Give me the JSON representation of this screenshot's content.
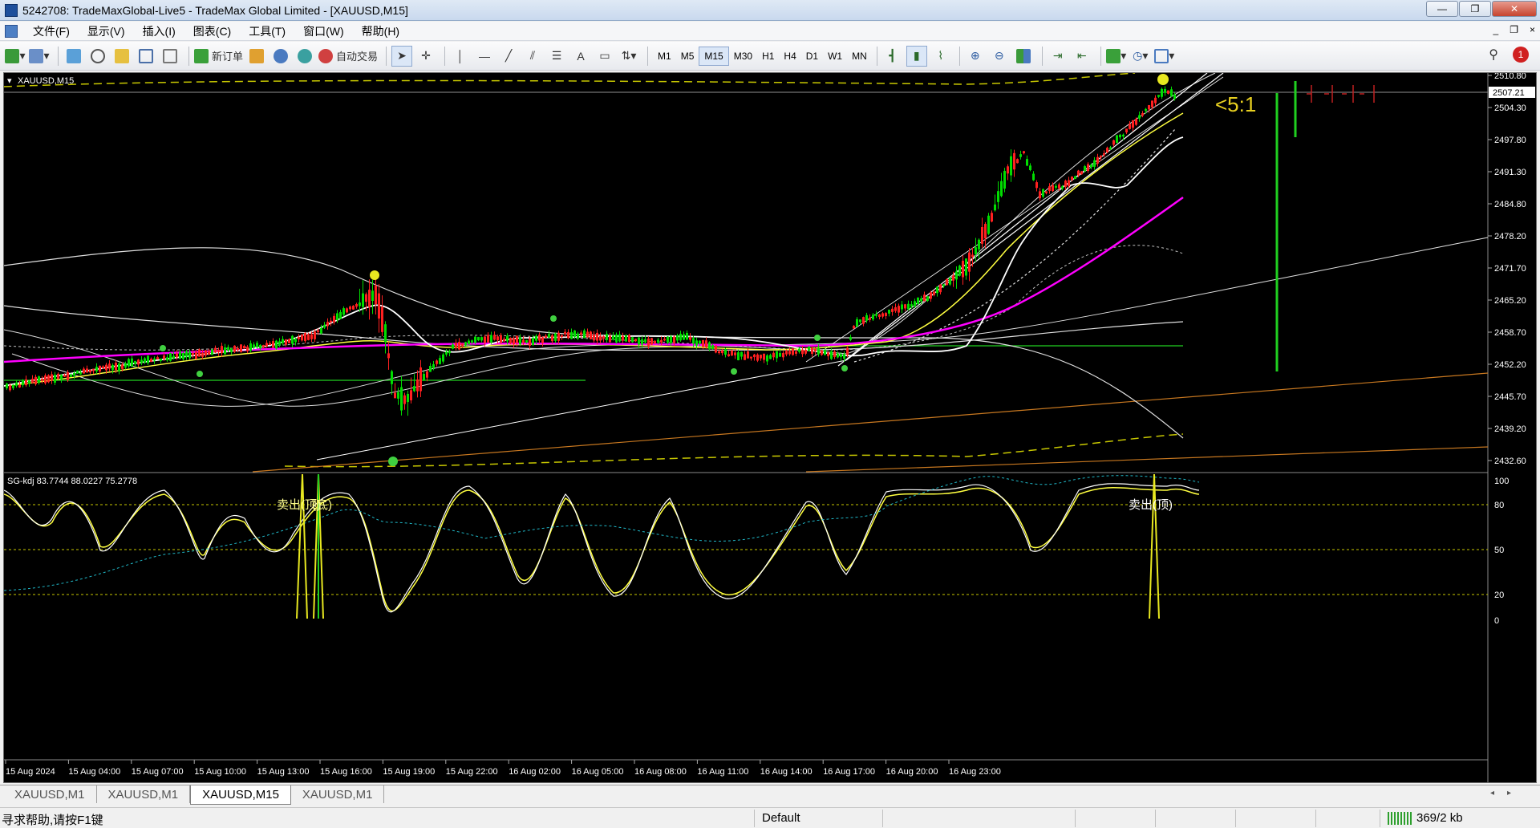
{
  "window": {
    "title": "5242708: TradeMaxGlobal-Live5 - TradeMax Global Limited - [XAUUSD,M15]",
    "buttons": [
      "—",
      "❐",
      "✕"
    ]
  },
  "menu": {
    "items": [
      "文件(F)",
      "显示(V)",
      "插入(I)",
      "图表(C)",
      "工具(T)",
      "窗口(W)",
      "帮助(H)"
    ],
    "mdi_buttons": [
      "_",
      "❐",
      "×"
    ]
  },
  "toolbar": {
    "new_order": "新订单",
    "auto_trade": "自动交易",
    "timeframes": [
      "M1",
      "M5",
      "M15",
      "M30",
      "H1",
      "H4",
      "D1",
      "W1",
      "MN"
    ],
    "active_timeframe": "M15",
    "notification_count": "1"
  },
  "chart": {
    "symbol_label": "XAUUSD,M15",
    "current_price": "2507.21",
    "ratio_label": "<5:1",
    "price_axis": [
      "2510.80",
      "2504.30",
      "2497.80",
      "2491.30",
      "2484.80",
      "2478.20",
      "2471.70",
      "2465.20",
      "2458.70",
      "2452.20",
      "2445.70",
      "2439.20",
      "2432.60"
    ],
    "indicator_label": "SG-kdj 83.7744 88.0227 75.2778",
    "indicator_axis": [
      "100",
      "80",
      "50",
      "20",
      "0"
    ],
    "signal_labels": [
      "卖出(顶)",
      "(底)",
      "卖出(顶)"
    ],
    "time_axis": [
      "15 Aug 2024",
      "15 Aug 04:00",
      "15 Aug 07:00",
      "15 Aug 10:00",
      "15 Aug 13:00",
      "15 Aug 16:00",
      "15 Aug 19:00",
      "15 Aug 22:00",
      "16 Aug 02:00",
      "16 Aug 05:00",
      "16 Aug 08:00",
      "16 Aug 11:00",
      "16 Aug 14:00",
      "16 Aug 17:00",
      "16 Aug 20:00",
      "16 Aug 23:00"
    ],
    "colors": {
      "bull": "#00dd00",
      "bear": "#ff2020",
      "ma_fast": "#ffff40",
      "ma_slow": "#ff00ff",
      "trend": "#ffffff",
      "band": "#cccc00",
      "orange": "#d08020"
    }
  },
  "tabs": {
    "items": [
      "XAUUSD,M1",
      "XAUUSD,M1",
      "XAUUSD,M15",
      "XAUUSD,M1"
    ],
    "active_index": 2
  },
  "status": {
    "help": "寻求帮助,请按F1键",
    "profile": "Default",
    "connection": "369/2 kb"
  }
}
